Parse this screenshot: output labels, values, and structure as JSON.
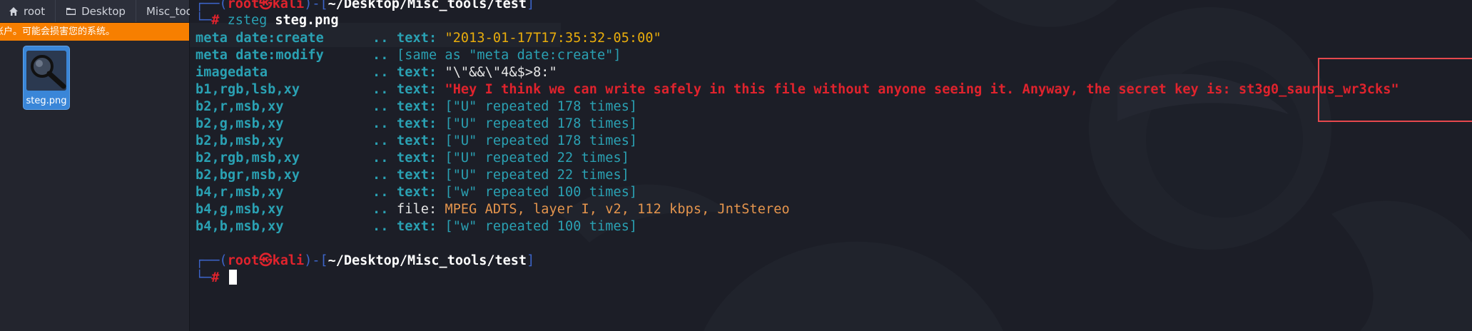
{
  "file_manager": {
    "breadcrumbs": [
      "root",
      "Desktop",
      "Misc_tools"
    ],
    "warning": "户。可能会损害您的系统。",
    "warning_full": "账户。可能会损害您的系统。",
    "file": {
      "name": "steg.png",
      "icon": "magnifier-image-icon"
    }
  },
  "terminal": {
    "prompt": {
      "top_left": "┌──(",
      "user": "root",
      "skull": "㉿",
      "host": "kali",
      "mid": ")-[",
      "path": "~/Desktop/Misc_tools/test",
      "close": "]",
      "bottom": "└─",
      "hash": "#"
    },
    "command": {
      "bin": "zsteg",
      "arg": "steg.png"
    },
    "rows": [
      {
        "key": "meta date:create",
        "dots": "..",
        "kind": "text:",
        "value": "\"2013-01-17T17:35:32-05:00\"",
        "style": "yel"
      },
      {
        "key": "meta date:modify",
        "dots": "..",
        "kind": "",
        "value": "[same as \"meta date:create\"]",
        "style": "cyan"
      },
      {
        "key": "imagedata",
        "dots": "..",
        "kind": "text:",
        "value": "\"\\\"&&\\\"4&$>8:\"",
        "style": "lt"
      },
      {
        "key": "b1,rgb,lsb,xy",
        "dots": "..",
        "kind": "text:",
        "value": "\"Hey I think we can write safely in this file without anyone seeing it. Anyway, the secret key is: st3g0_saurus_wr3cks\"",
        "style": "red"
      },
      {
        "key": "b2,r,msb,xy",
        "dots": "..",
        "kind": "text:",
        "value": "[\"U\" repeated 178 times]",
        "style": "cyan"
      },
      {
        "key": "b2,g,msb,xy",
        "dots": "..",
        "kind": "text:",
        "value": "[\"U\" repeated 178 times]",
        "style": "cyan"
      },
      {
        "key": "b2,b,msb,xy",
        "dots": "..",
        "kind": "text:",
        "value": "[\"U\" repeated 178 times]",
        "style": "cyan"
      },
      {
        "key": "b2,rgb,msb,xy",
        "dots": "..",
        "kind": "text:",
        "value": "[\"U\" repeated 22 times]",
        "style": "cyan"
      },
      {
        "key": "b2,bgr,msb,xy",
        "dots": "..",
        "kind": "text:",
        "value": "[\"U\" repeated 22 times]",
        "style": "cyan"
      },
      {
        "key": "b4,r,msb,xy",
        "dots": "..",
        "kind": "text:",
        "value": "[\"w\" repeated 100 times]",
        "style": "cyan"
      },
      {
        "key": "b4,g,msb,xy",
        "dots": "..",
        "kind": "file:",
        "value": "MPEG ADTS, layer I, v2, 112 kbps, JntStereo",
        "style": "orange"
      },
      {
        "key": "b4,b,msb,xy",
        "dots": "..",
        "kind": "text:",
        "value": "[\"w\" repeated 100 times]",
        "style": "cyan"
      }
    ]
  },
  "colors": {
    "highlight_box": "#e5484d",
    "warning_bar": "#f77f00",
    "selected_file": "#3a86d8"
  }
}
